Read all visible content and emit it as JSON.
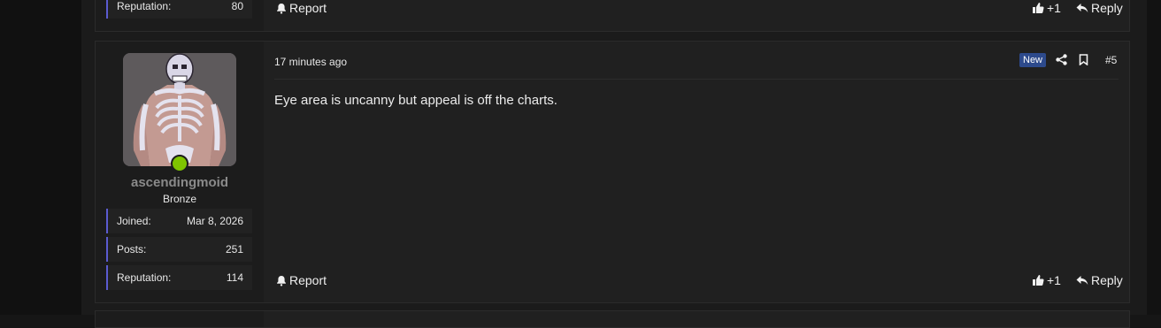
{
  "previous_post": {
    "reputation_label": "Reputation:",
    "reputation_value": "80",
    "report_label": "Report",
    "like_count": "+1",
    "reply_label": "Reply"
  },
  "post": {
    "author": {
      "username": "ascendingmoid",
      "rank": "Bronze",
      "online": true,
      "stats": [
        {
          "label": "Joined:",
          "value": "Mar 8, 2026"
        },
        {
          "label": "Posts:",
          "value": "251"
        },
        {
          "label": "Reputation:",
          "value": "114"
        }
      ]
    },
    "timestamp": "17 minutes ago",
    "new_badge": "New",
    "post_number": "#5",
    "message": "Eye area is uncanny but appeal is off the charts.",
    "report_label": "Report",
    "like_count": "+1",
    "reply_label": "Reply"
  },
  "icons": {
    "report": "bell-icon",
    "like": "thumbs-up-icon",
    "reply": "reply-arrow-icon",
    "share": "share-icon",
    "bookmark": "bookmark-icon"
  },
  "colors": {
    "accent_border": "#5b5bd0",
    "online": "#7fc400",
    "new_badge": "#2d4a8c",
    "username": "#8a8a8a"
  }
}
